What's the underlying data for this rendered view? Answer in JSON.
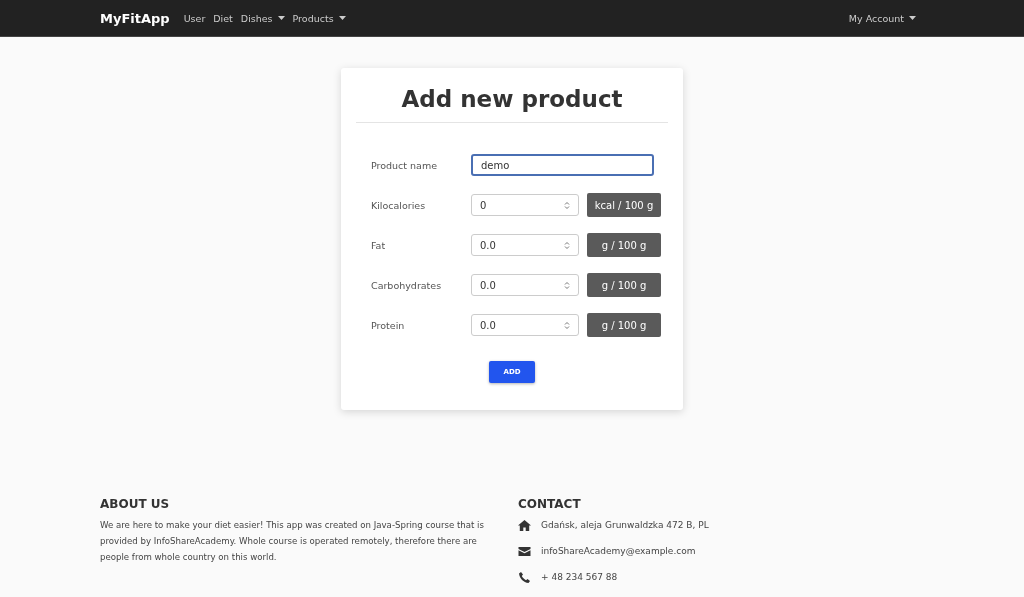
{
  "navbar": {
    "brand": "MyFitApp",
    "items": [
      {
        "label": "User",
        "dropdown": false
      },
      {
        "label": "Diet",
        "dropdown": false
      },
      {
        "label": "Dishes",
        "dropdown": true
      },
      {
        "label": "Products",
        "dropdown": true
      }
    ],
    "account": {
      "label": "My Account",
      "dropdown": true
    }
  },
  "form": {
    "title": "Add new product",
    "name_field": {
      "label": "Product name",
      "value": "demo",
      "focused": true
    },
    "fields": [
      {
        "label": "Kilocalories",
        "value": "0",
        "unit": "kcal / 100 g"
      },
      {
        "label": "Fat",
        "value": "0.0",
        "unit": "g / 100 g"
      },
      {
        "label": "Carbohydrates",
        "value": "0.0",
        "unit": "g / 100 g"
      },
      {
        "label": "Protein",
        "value": "0.0",
        "unit": "g / 100 g"
      }
    ],
    "submit": "ADD"
  },
  "footer": {
    "about": {
      "heading": "ABOUT US",
      "text": "We are here to make your diet easier! This app was created on Java-Spring course that is provided by InfoShareAcademy. Whole course is operated remotely, therefore there are people from whole country on this world."
    },
    "contact": {
      "heading": "CONTACT",
      "items": [
        {
          "kind": "home",
          "text": "Gdańsk, aleja Grunwaldzka 472 B, PL"
        },
        {
          "kind": "mail",
          "text": "infoShareAcademy@example.com"
        },
        {
          "kind": "phone",
          "text": "+ 48 234 567 88"
        }
      ]
    }
  }
}
